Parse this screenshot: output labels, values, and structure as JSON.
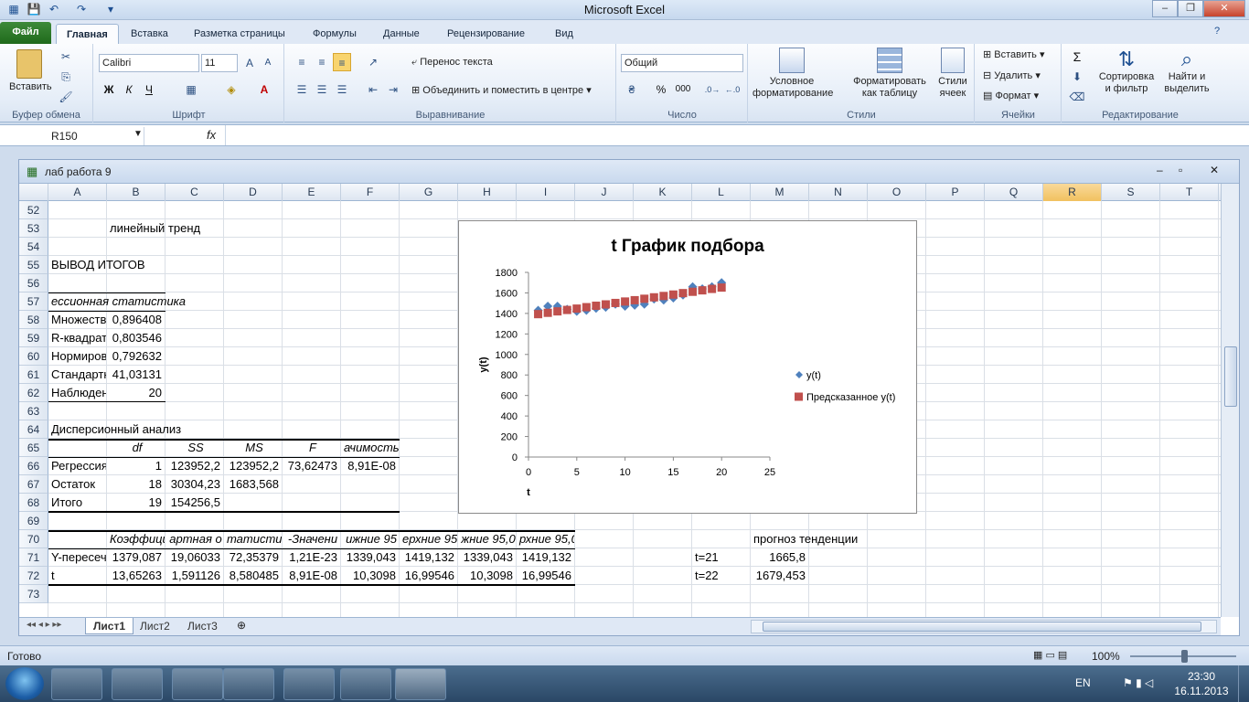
{
  "window": {
    "title": "Microsoft Excel"
  },
  "ribbon": {
    "tabs": [
      "Файл",
      "Главная",
      "Вставка",
      "Разметка страницы",
      "Формулы",
      "Данные",
      "Рецензирование",
      "Вид"
    ],
    "clipboard": {
      "paste": "Вставить",
      "label": "Буфер обмена"
    },
    "font": {
      "name": "Calibri",
      "size": "11",
      "bold": "Ж",
      "italic": "К",
      "underline": "Ч",
      "label": "Шрифт"
    },
    "alignment": {
      "wrap": "Перенос текста",
      "merge": "Объединить и поместить в центре",
      "label": "Выравнивание"
    },
    "number": {
      "format": "Общий",
      "percent": "%",
      "thousands": "000",
      "label": "Число"
    },
    "styles": {
      "conditional": "Условное\nформатирование",
      "format_table": "Форматировать\nкак таблицу",
      "cell_styles": "Стили\nячеек",
      "label": "Стили"
    },
    "cells": {
      "insert": "Вставить",
      "delete": "Удалить",
      "format": "Формат",
      "label": "Ячейки"
    },
    "editing": {
      "sum": "Σ",
      "sort": "Сортировка\nи фильтр",
      "find": "Найти и\nвыделить",
      "label": "Редактирование"
    }
  },
  "formula_bar": {
    "name_box": "R150",
    "fx": "fx",
    "value": ""
  },
  "workbook": {
    "title": "лаб работа 9",
    "columns": [
      "A",
      "B",
      "C",
      "D",
      "E",
      "F",
      "G",
      "H",
      "I",
      "J",
      "K",
      "L",
      "M",
      "N",
      "O",
      "P",
      "Q",
      "R",
      "S",
      "T"
    ],
    "selected_column": "R",
    "rows": [
      "52",
      "53",
      "54",
      "55",
      "56",
      "57",
      "58",
      "59",
      "60",
      "61",
      "62",
      "63",
      "64",
      "65",
      "66",
      "67",
      "68",
      "69",
      "70",
      "71",
      "72",
      "73"
    ],
    "cells": {
      "b53": "линейный тренд",
      "a55": "ВЫВОД ИТОГОВ",
      "a57": "ессионная статистика",
      "a58": "Множеств",
      "b58": "0,896408",
      "a59": "R-квадрат",
      "b59": "0,803546",
      "a60": "Нормиров",
      "b60": "0,792632",
      "a61": "Стандартн",
      "b61": "41,03131",
      "a62": "Наблюден",
      "b62": "20",
      "a64": "Дисперсионный анализ",
      "b65": "df",
      "c65": "SS",
      "d65": "MS",
      "e65": "F",
      "f65": "ачимость F",
      "a66": "Регрессия",
      "b66": "1",
      "c66": "123952,2",
      "d66": "123952,2",
      "e66": "73,62473",
      "f66": "8,91E-08",
      "a67": "Остаток",
      "b67": "18",
      "c67": "30304,23",
      "d67": "1683,568",
      "a68": "Итого",
      "b68": "19",
      "c68": "154256,5",
      "b70": "Коэффициен",
      "c70": "артная о",
      "d70": "татистик",
      "e70": "-Значени",
      "f70": "ижние 95",
      "g70": "ерхние 95",
      "h70": "жние 95,0",
      "i70": "рхние 95,0%",
      "m70": "прогноз тенденции",
      "a71": "Y-пересеч",
      "b71": "1379,087",
      "c71": "19,06033",
      "d71": "72,35379",
      "e71": "1,21E-23",
      "f71": "1339,043",
      "g71": "1419,132",
      "h71": "1339,043",
      "i71": "1419,132",
      "l71": "t=21",
      "m71": "1665,8",
      "a72": "t",
      "b72": "13,65263",
      "c72": "1,591126",
      "d72": "8,580485",
      "e72": "8,91E-08",
      "f72": "10,3098",
      "g72": "16,99546",
      "h72": "10,3098",
      "i72": "16,99546",
      "l72": "t=22",
      "m72": "1679,453"
    },
    "sheets": [
      "Лист1",
      "Лист2",
      "Лист3"
    ]
  },
  "status": {
    "ready": "Готово",
    "zoom": "100%"
  },
  "taskbar": {
    "lang": "EN",
    "time": "23:30",
    "date": "16.11.2013"
  },
  "chart_data": {
    "type": "scatter",
    "title": "t График подбора",
    "xlabel": "t",
    "ylabel": "y(t)",
    "xlim": [
      0,
      25
    ],
    "ylim": [
      0,
      1800
    ],
    "xticks": [
      0,
      5,
      10,
      15,
      20,
      25
    ],
    "yticks": [
      0,
      200,
      400,
      600,
      800,
      1000,
      1200,
      1400,
      1600,
      1800
    ],
    "legend_position": "right",
    "series": [
      {
        "name": "y(t)",
        "color": "#4f81bd",
        "marker": "diamond",
        "x": [
          1,
          2,
          3,
          4,
          5,
          6,
          7,
          8,
          9,
          10,
          11,
          12,
          13,
          14,
          15,
          16,
          17,
          18,
          19,
          20
        ],
        "y": [
          1430,
          1470,
          1470,
          1440,
          1420,
          1430,
          1450,
          1460,
          1490,
          1470,
          1480,
          1490,
          1540,
          1530,
          1550,
          1580,
          1660,
          1640,
          1660,
          1700
        ]
      },
      {
        "name": "Предсказанное y(t)",
        "color": "#c0504d",
        "marker": "square",
        "x": [
          1,
          2,
          3,
          4,
          5,
          6,
          7,
          8,
          9,
          10,
          11,
          12,
          13,
          14,
          15,
          16,
          17,
          18,
          19,
          20
        ],
        "y": [
          1393,
          1406,
          1420,
          1434,
          1447,
          1461,
          1475,
          1488,
          1502,
          1516,
          1529,
          1543,
          1557,
          1570,
          1584,
          1598,
          1611,
          1625,
          1639,
          1652
        ]
      }
    ]
  }
}
